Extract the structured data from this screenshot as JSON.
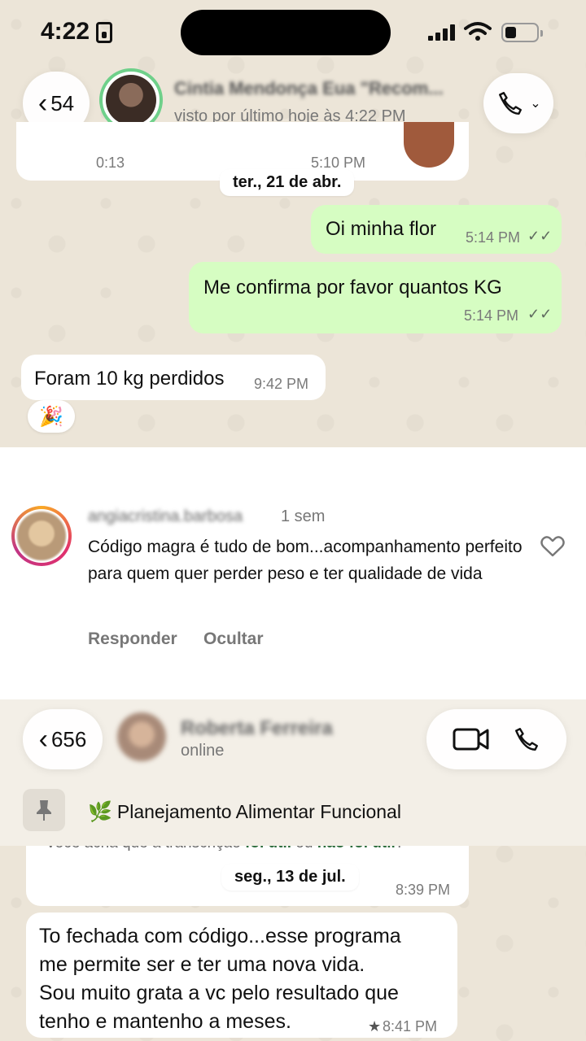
{
  "status_bar": {
    "time": "4:22"
  },
  "chat1": {
    "back_count": "54",
    "contact_name": "Cintia Mendonça Eua \"Recom...",
    "contact_status": "visto por último hoje às 4:22 PM",
    "prev_message": {
      "duration": "0:13",
      "time": "5:10 PM"
    },
    "date_separator": "ter., 21 de abr.",
    "messages": [
      {
        "text": "Oi minha flor",
        "time": "5:14 PM",
        "direction": "outgoing"
      },
      {
        "text": "Me confirma por favor quantos KG",
        "time": "5:14 PM",
        "direction": "outgoing"
      },
      {
        "text": "Foram 10 kg perdidos",
        "time": "9:42 PM",
        "direction": "incoming"
      }
    ],
    "reaction": "🎉"
  },
  "comment": {
    "username": "angiacristina.barbosa",
    "age": "1 sem",
    "text": "Código magra é tudo de bom...acompanhamento perfeito para quem quer perder peso e ter qualidade de vida",
    "reply_label": "Responder",
    "hide_label": "Ocultar"
  },
  "chat2": {
    "back_count": "656",
    "contact_name": "Roberta Ferreira",
    "contact_status": "online",
    "pinned_message": "Planejamento Alimentar Funcional",
    "prev_message": {
      "text_partial": "Você acha que a transcrição ",
      "link1": "foi útil",
      "or": " ou ",
      "link2": "não foi útil",
      "end": "?",
      "time": "8:39 PM"
    },
    "date_separator": "seg., 13 de jul.",
    "message": {
      "lines": [
        "To fechada com código...esse programa",
        "me permite ser e ter uma nova vida.",
        "Sou muito grata a vc pelo resultado que",
        "tenho e mantenho a meses."
      ],
      "time": "8:41 PM"
    }
  },
  "colors": {
    "outgoing_bubble": "#d6fdc2",
    "incoming_bubble": "#ffffff",
    "online_ring": "#6fd08a"
  }
}
